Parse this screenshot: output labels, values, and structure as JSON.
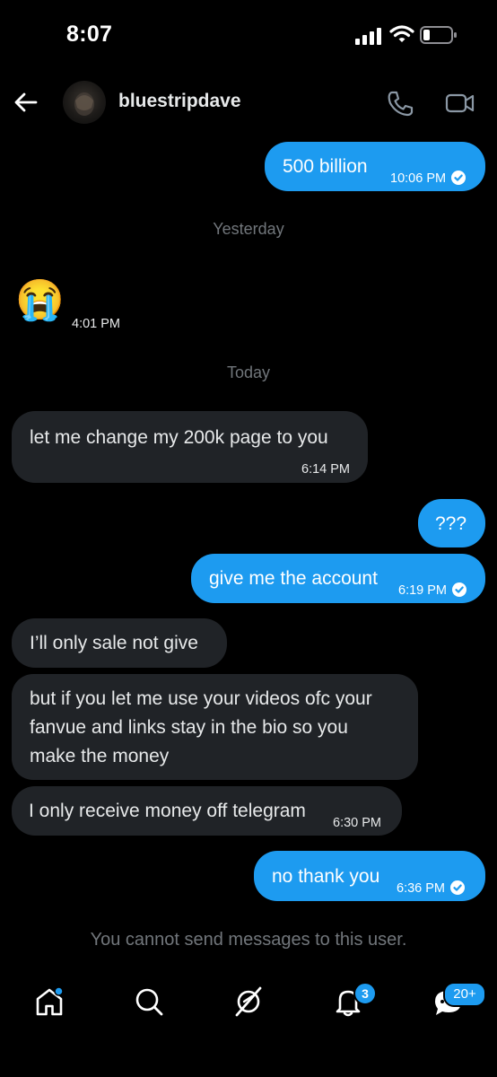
{
  "status_bar": {
    "time": "8:07"
  },
  "header": {
    "username": "bluestripdave"
  },
  "messages": [
    {
      "side": "sent",
      "text": "500 billion",
      "time": "10:06 PM",
      "read": true
    },
    {
      "divider": "Yesterday"
    },
    {
      "side": "recv",
      "emoji": "😭",
      "time": "4:01 PM"
    },
    {
      "divider": "Today"
    },
    {
      "side": "recv",
      "text": "let me change my 200k page to you",
      "time": "6:14 PM"
    },
    {
      "side": "sent",
      "text": "???"
    },
    {
      "side": "sent",
      "text": "give me the account",
      "time": "6:19 PM",
      "read": true
    },
    {
      "side": "recv",
      "text": "I’ll only sale not give"
    },
    {
      "side": "recv",
      "lines": [
        "but if you let me use your videos ofc your",
        "fanvue and links stay in the bio so you",
        "make the money"
      ]
    },
    {
      "side": "recv",
      "text": "I only receive money off telegram",
      "time": "6:30 PM"
    },
    {
      "side": "sent",
      "text": "no thank you",
      "time": "6:36 PM",
      "read": true
    }
  ],
  "notice": "You cannot send messages to this user.",
  "nav": {
    "items": [
      "home-icon",
      "search-icon",
      "grok-icon",
      "notifications-icon",
      "messages-icon"
    ],
    "notifications_badge": "3",
    "messages_badge": "20+"
  },
  "colors": {
    "background": "#000000",
    "sent_bubble": "#1d9bf0",
    "received_bubble": "#202327",
    "muted_text": "#71767b"
  }
}
